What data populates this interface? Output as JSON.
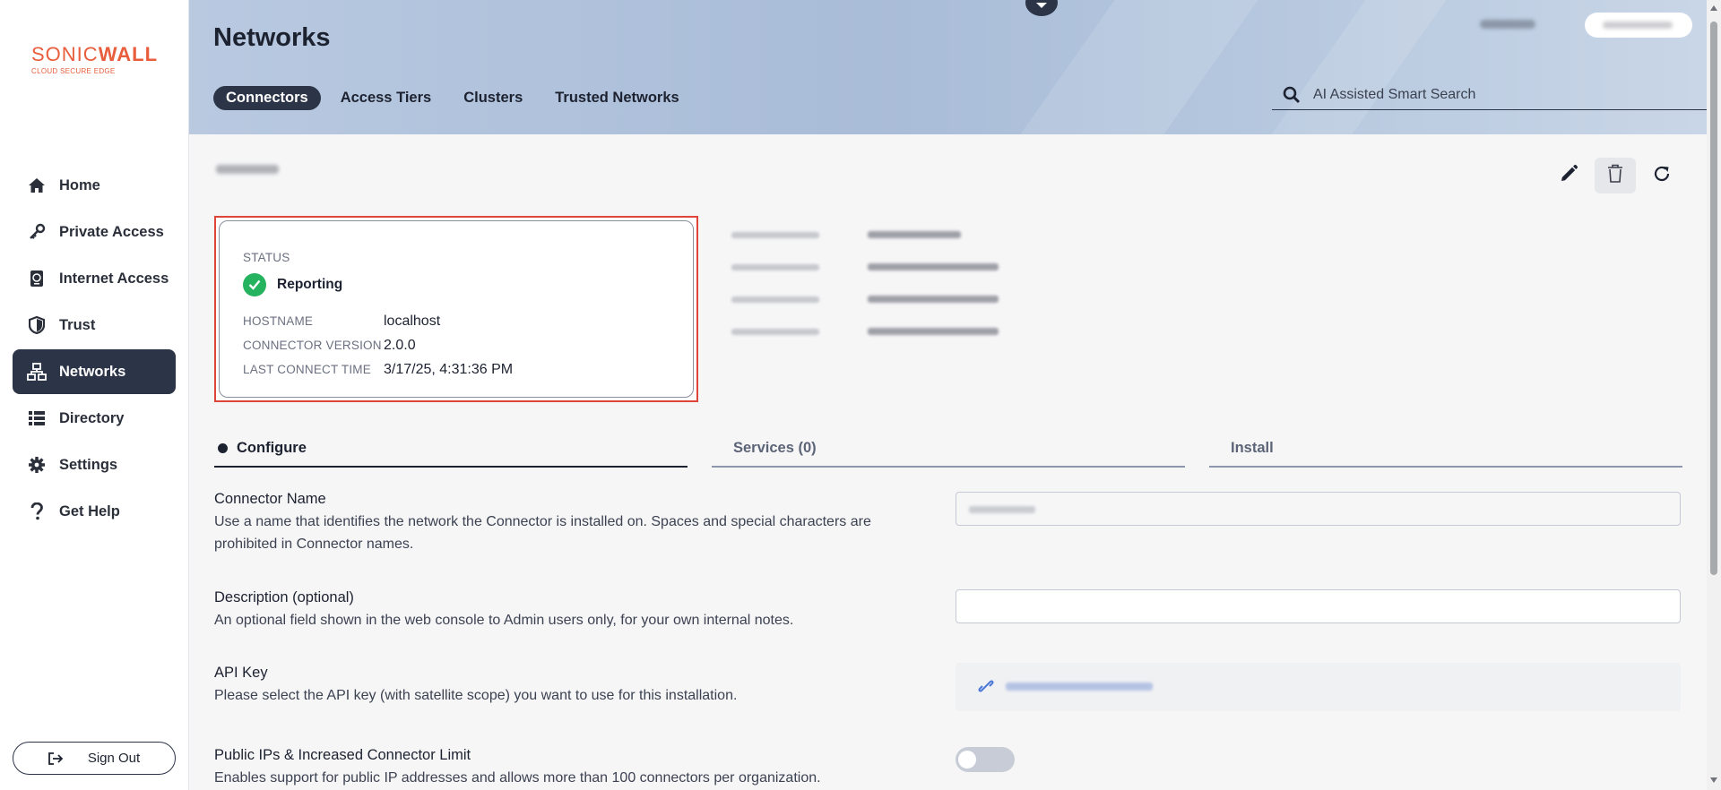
{
  "logo": {
    "brand_a": "SONIC",
    "brand_b": "WALL",
    "tagline": "CLOUD SECURE EDGE"
  },
  "sidebar": {
    "items": [
      {
        "label": "Home",
        "icon": "home-icon"
      },
      {
        "label": "Private Access",
        "icon": "key-icon"
      },
      {
        "label": "Internet Access",
        "icon": "globe-tablet-icon"
      },
      {
        "label": "Trust",
        "icon": "shield-icon"
      },
      {
        "label": "Networks",
        "icon": "network-icon",
        "active": true
      },
      {
        "label": "Directory",
        "icon": "list-icon"
      },
      {
        "label": "Settings",
        "icon": "gear-icon"
      },
      {
        "label": "Get Help",
        "icon": "question-icon"
      }
    ],
    "signout_label": "Sign Out"
  },
  "header": {
    "title": "Networks",
    "tabs": [
      {
        "label": "Connectors",
        "active": true
      },
      {
        "label": "Access Tiers"
      },
      {
        "label": "Clusters"
      },
      {
        "label": "Trusted Networks"
      }
    ],
    "search_placeholder": "AI Assisted Smart Search"
  },
  "status_card": {
    "status_label": "STATUS",
    "status_value": "Reporting",
    "hostname_label": "HOSTNAME",
    "hostname_value": "localhost",
    "version_label": "CONNECTOR VERSION",
    "version_value": "2.0.0",
    "last_connect_label": "LAST CONNECT TIME",
    "last_connect_value": "3/17/25, 4:31:36 PM"
  },
  "section_tabs": [
    {
      "label": "Configure",
      "active": true
    },
    {
      "label": "Services (0)"
    },
    {
      "label": "Install"
    }
  ],
  "form": {
    "connector_name_title": "Connector Name",
    "connector_name_desc": "Use a name that identifies the network the Connector is installed on. Spaces and special characters are prohibited in Connector names.",
    "description_title": "Description (optional)",
    "description_desc": "An optional field shown in the web console to Admin users only, for your own internal notes.",
    "api_key_title": "API Key",
    "api_key_desc": "Please select the API key (with satellite scope) you want to use for this installation.",
    "public_ips_title": "Public IPs & Increased Connector Limit",
    "public_ips_desc": "Enables support for public IP addresses and allows more than 100 connectors per organization.",
    "public_ips_enabled": false
  },
  "colors": {
    "accent": "#2c3447",
    "brand": "#e85d3b",
    "success": "#25b35f",
    "highlight_border": "#e0453a"
  }
}
